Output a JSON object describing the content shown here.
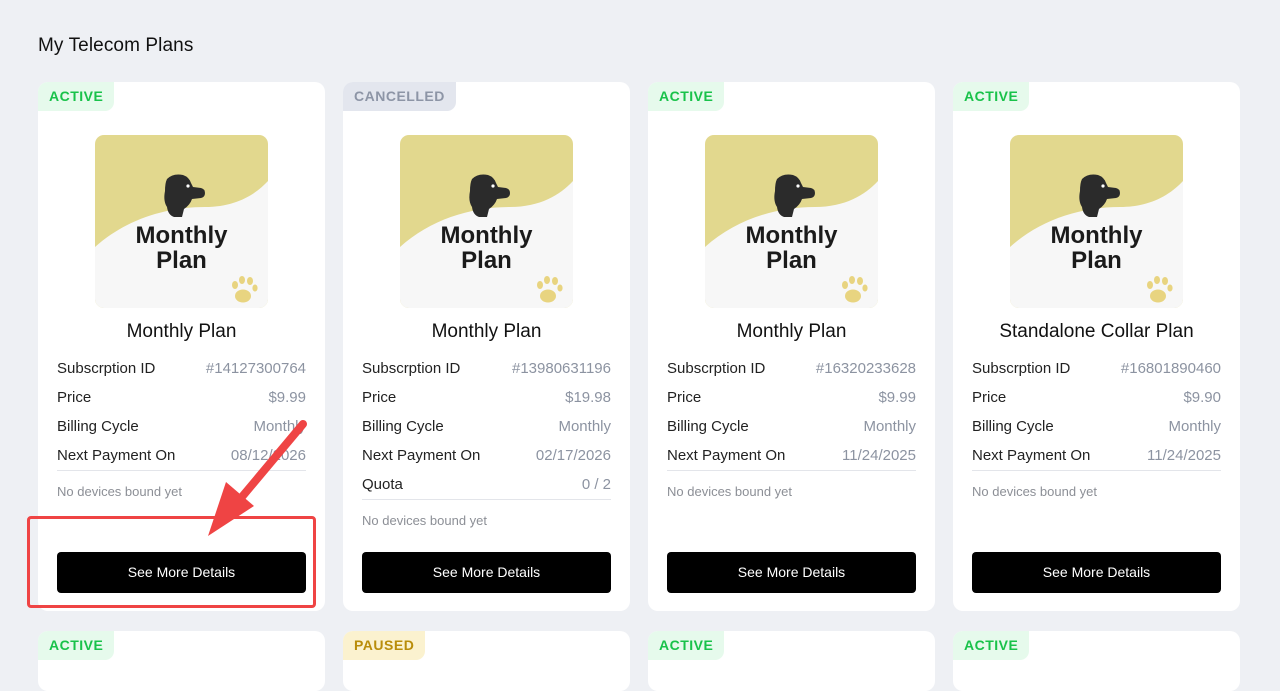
{
  "page_title": "My Telecom Plans",
  "cards": [
    {
      "status": "ACTIVE",
      "status_type": "active",
      "thumb_text_line1": "Monthly",
      "thumb_text_line2": "Plan",
      "name": "Monthly Plan",
      "rows": [
        {
          "label": "Subscrption ID",
          "value": "#14127300764"
        },
        {
          "label": "Price",
          "value": "$9.99"
        },
        {
          "label": "Billing Cycle",
          "value": "Monthly"
        },
        {
          "label": "Next Payment On",
          "value": "08/12/2026"
        }
      ],
      "devices": "No devices bound yet",
      "button": "See More Details"
    },
    {
      "status": "CANCELLED",
      "status_type": "cancelled",
      "thumb_text_line1": "Monthly",
      "thumb_text_line2": "Plan",
      "name": "Monthly Plan",
      "rows": [
        {
          "label": "Subscrption ID",
          "value": "#13980631196"
        },
        {
          "label": "Price",
          "value": "$19.98"
        },
        {
          "label": "Billing Cycle",
          "value": "Monthly"
        },
        {
          "label": "Next Payment On",
          "value": "02/17/2026"
        },
        {
          "label": "Quota",
          "value": "0 / 2"
        }
      ],
      "devices": "No devices bound yet",
      "button": "See More Details"
    },
    {
      "status": "ACTIVE",
      "status_type": "active",
      "thumb_text_line1": "Monthly",
      "thumb_text_line2": "Plan",
      "name": "Monthly Plan",
      "rows": [
        {
          "label": "Subscrption ID",
          "value": "#16320233628"
        },
        {
          "label": "Price",
          "value": "$9.99"
        },
        {
          "label": "Billing Cycle",
          "value": "Monthly"
        },
        {
          "label": "Next Payment On",
          "value": "11/24/2025"
        }
      ],
      "devices": "No devices bound yet",
      "button": "See More Details"
    },
    {
      "status": "ACTIVE",
      "status_type": "active",
      "thumb_text_line1": "Monthly",
      "thumb_text_line2": "Plan",
      "name": "Standalone Collar Plan",
      "rows": [
        {
          "label": "Subscrption ID",
          "value": "#16801890460"
        },
        {
          "label": "Price",
          "value": "$9.90"
        },
        {
          "label": "Billing Cycle",
          "value": "Monthly"
        },
        {
          "label": "Next Payment On",
          "value": "11/24/2025"
        }
      ],
      "devices": "No devices bound yet",
      "button": "See More Details"
    }
  ],
  "next_row_badges": [
    {
      "status": "ACTIVE",
      "status_type": "active"
    },
    {
      "status": "PAUSED",
      "status_type": "paused"
    },
    {
      "status": "ACTIVE",
      "status_type": "active"
    },
    {
      "status": "ACTIVE",
      "status_type": "active"
    }
  ],
  "colors": {
    "thumb_bg": "#e2d88e",
    "thumb_wave": "#f7f7f7",
    "paw": "#e8d480",
    "dog": "#2b2b2b",
    "annotation": "#ef4444"
  },
  "icons": [
    "dog-icon",
    "paw-icon",
    "annotation-arrow-icon"
  ]
}
